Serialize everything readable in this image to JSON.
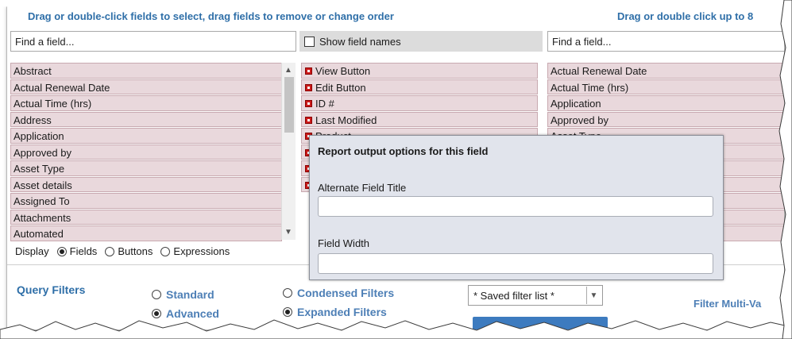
{
  "header": {
    "left_hint": "Drag or double-click fields to select, drag fields to remove or change order",
    "right_hint": "Drag or double click up to 8"
  },
  "search": {
    "left_placeholder": "Find a field...",
    "right_placeholder": "Find a field..."
  },
  "show_field_names": {
    "label": "Show field names",
    "checked": false
  },
  "available_fields": [
    "Abstract",
    "Actual Renewal Date",
    "Actual Time (hrs)",
    "Address",
    "Application",
    "Approved by",
    "Asset Type",
    "Asset details",
    "Assigned To",
    "Attachments",
    "Automated"
  ],
  "selected_fields": [
    "View Button",
    "Edit Button",
    "ID #",
    "Last Modified",
    "Product",
    "",
    "",
    ""
  ],
  "right_fields": [
    "Actual Renewal Date",
    "Actual Time (hrs)",
    "Application",
    "Approved by",
    "Asset Type",
    "",
    "",
    "",
    "",
    "",
    ""
  ],
  "display": {
    "label": "Display",
    "options": [
      "Fields",
      "Buttons",
      "Expressions"
    ],
    "selected": "Fields"
  },
  "popup": {
    "title": "Report output options for this field",
    "alt_title_label": "Alternate Field Title",
    "width_label": "Field Width"
  },
  "query_filters": {
    "title": "Query Filters",
    "options_a": [
      "Standard",
      "Advanced"
    ],
    "selected_a": "Advanced",
    "options_b": [
      "Condensed Filters",
      "Expanded Filters"
    ],
    "selected_b": "Expanded Filters",
    "saved_filter": "* Saved filter list *",
    "filter_multi": "Filter Multi-Va"
  },
  "colors": {
    "accent": "#2f6fa8",
    "field_bg": "#e9d8dc",
    "marker": "#cc1a1a",
    "popup_bg": "#e1e4ec"
  }
}
